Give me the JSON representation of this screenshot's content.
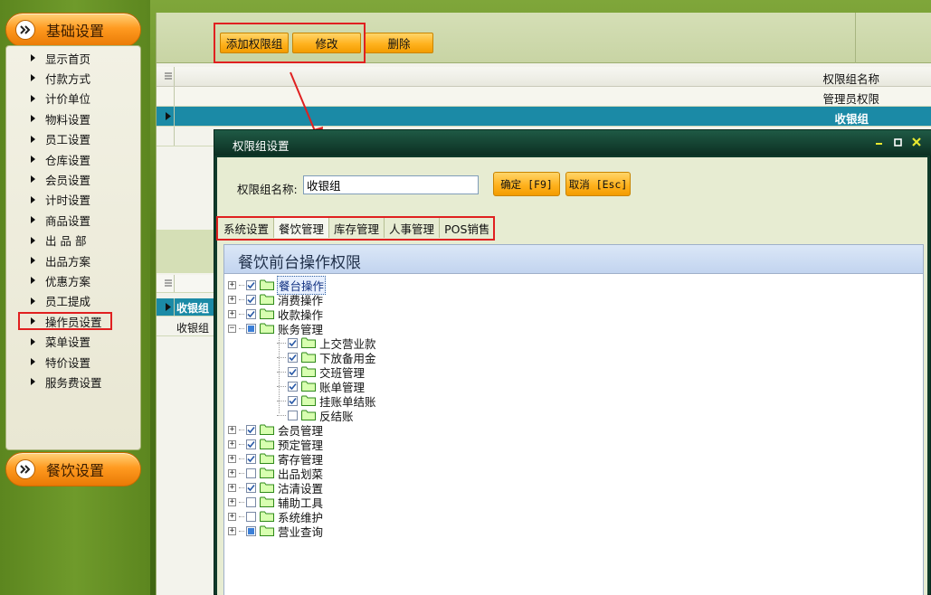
{
  "sidebar": {
    "header_top": "基础设置",
    "header_bottom": "餐饮设置",
    "items": [
      {
        "label": "显示首页"
      },
      {
        "label": "付款方式"
      },
      {
        "label": "计价单位"
      },
      {
        "label": "物料设置"
      },
      {
        "label": "员工设置"
      },
      {
        "label": "仓库设置"
      },
      {
        "label": "会员设置"
      },
      {
        "label": "计时设置"
      },
      {
        "label": "商品设置"
      },
      {
        "label": "出 品 部"
      },
      {
        "label": "出品方案"
      },
      {
        "label": "优惠方案"
      },
      {
        "label": "员工提成"
      },
      {
        "label": "操作员设置"
      },
      {
        "label": "菜单设置"
      },
      {
        "label": "特价设置"
      },
      {
        "label": "服务费设置"
      }
    ],
    "selected_index": 13
  },
  "toolbar": {
    "add_label": "添加权限组",
    "edit_label": "修改",
    "delete_label": "删除"
  },
  "grid": {
    "column_header": "权限组名称",
    "rows": [
      "管理员权限",
      "收银组"
    ],
    "lower_rows": [
      "收银组",
      "收银组"
    ]
  },
  "dialog": {
    "title": "权限组设置",
    "name_label": "权限组名称:",
    "name_value": "收银组",
    "ok_label": "确定 [F9]",
    "cancel_label": "取消 [Esc]",
    "tabs": [
      "系统设置",
      "餐饮管理",
      "库存管理",
      "人事管理",
      "POS销售"
    ],
    "active_tab": 1,
    "tree_title": "餐饮前台操作权限",
    "tree": [
      {
        "label": "餐台操作",
        "state": "checked",
        "expanded": false,
        "level": 0,
        "selected": true
      },
      {
        "label": "消费操作",
        "state": "checked",
        "expanded": false,
        "level": 0
      },
      {
        "label": "收款操作",
        "state": "checked",
        "expanded": false,
        "level": 0
      },
      {
        "label": "账务管理",
        "state": "partial",
        "expanded": true,
        "level": 0
      },
      {
        "label": "上交营业款",
        "state": "checked",
        "level": 1
      },
      {
        "label": "下放备用金",
        "state": "checked",
        "level": 1
      },
      {
        "label": "交班管理",
        "state": "checked",
        "level": 1
      },
      {
        "label": "账单管理",
        "state": "checked",
        "level": 1
      },
      {
        "label": "挂账单结账",
        "state": "checked",
        "level": 1
      },
      {
        "label": "反结账",
        "state": "unchecked",
        "level": 1
      },
      {
        "label": "会员管理",
        "state": "checked",
        "expanded": false,
        "level": 0
      },
      {
        "label": "预定管理",
        "state": "checked",
        "expanded": false,
        "level": 0
      },
      {
        "label": "寄存管理",
        "state": "checked",
        "expanded": false,
        "level": 0
      },
      {
        "label": "出品划菜",
        "state": "unchecked",
        "expanded": false,
        "level": 0
      },
      {
        "label": "沽清设置",
        "state": "checked",
        "expanded": false,
        "level": 0
      },
      {
        "label": "辅助工具",
        "state": "unchecked",
        "expanded": false,
        "level": 0
      },
      {
        "label": "系统维护",
        "state": "unchecked",
        "expanded": false,
        "level": 0
      },
      {
        "label": "营业查询",
        "state": "partial",
        "expanded": false,
        "level": 0
      }
    ]
  },
  "colors": {
    "accent_orange": "#ffb21e",
    "selection_teal": "#1b8aa6",
    "annotation_red": "#e02020"
  }
}
